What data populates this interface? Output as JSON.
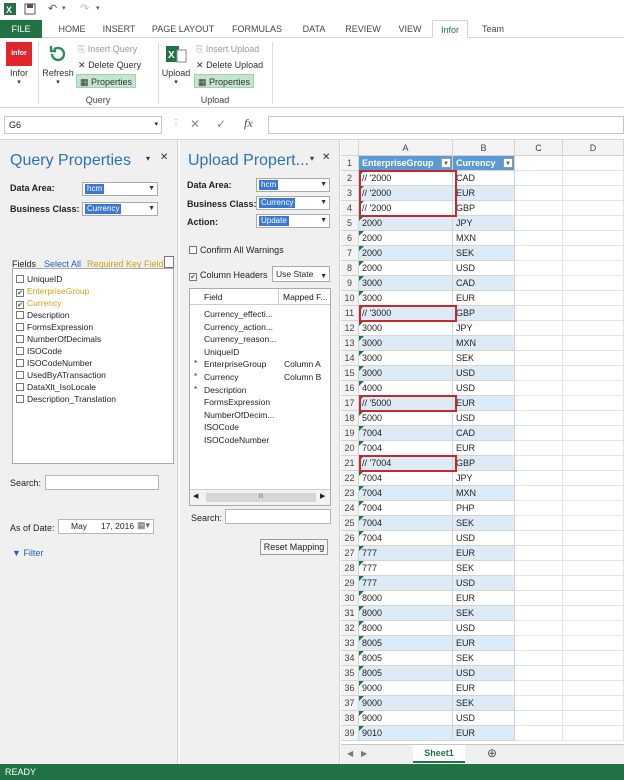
{
  "ribbon": {
    "tabs": [
      "FILE",
      "HOME",
      "INSERT",
      "PAGE LAYOUT",
      "FORMULAS",
      "DATA",
      "REVIEW",
      "VIEW",
      "Infor",
      "Team"
    ],
    "infor_label": "Infor",
    "refresh_label": "Refresh",
    "insert_query": "Insert Query",
    "delete_query": "Delete Query",
    "properties": "Properties",
    "query_group": "Query",
    "upload_label": "Upload",
    "insert_upload": "Insert Upload",
    "delete_upload": "Delete Upload",
    "upload_group": "Upload",
    "accent": "#217346"
  },
  "formula_bar": {
    "name_box": "G6",
    "fx": "fx"
  },
  "query_pane": {
    "title": "Query Properties",
    "data_area_label": "Data Area:",
    "data_area_value": "hcm",
    "business_class_label": "Business Class:",
    "business_class_value": "Currency",
    "fields_label": "Fields",
    "select_all": "Select All",
    "required_key_fields": "Required Key Fields",
    "fields": [
      {
        "name": "UniqueID",
        "checked": false
      },
      {
        "name": "EnterpriseGroup",
        "checked": true
      },
      {
        "name": "Currency",
        "checked": true
      },
      {
        "name": "Description",
        "checked": false
      },
      {
        "name": "FormsExpression",
        "checked": false
      },
      {
        "name": "NumberOfDecimals",
        "checked": false
      },
      {
        "name": "ISOCode",
        "checked": false
      },
      {
        "name": "ISOCodeNumber",
        "checked": false
      },
      {
        "name": "UsedByATransaction",
        "checked": false
      },
      {
        "name": "DataXlt_IsoLocale",
        "checked": false
      },
      {
        "name": "Description_Translation",
        "checked": false
      }
    ],
    "search_label": "Search:",
    "as_of_label": "As of Date:",
    "as_of_month": "May",
    "as_of_day_year": "17, 2016",
    "filter_label": "Filter"
  },
  "upload_pane": {
    "title": "Upload Propert...",
    "data_area_label": "Data Area:",
    "data_area_value": "hcm",
    "business_class_label": "Business Class:",
    "business_class_value": "Currency",
    "action_label": "Action:",
    "action_value": "Update",
    "confirm_all": "Confirm All Warnings",
    "column_headers": "Column Headers",
    "use_state": "Use State",
    "col_field": "Field",
    "col_mapped": "Mapped F...",
    "rows": [
      {
        "star": "",
        "field": "Currency_effecti...",
        "mapped": ""
      },
      {
        "star": "",
        "field": "Currency_action...",
        "mapped": ""
      },
      {
        "star": "",
        "field": "Currency_reason...",
        "mapped": ""
      },
      {
        "star": "",
        "field": "UniqueID",
        "mapped": ""
      },
      {
        "star": "*",
        "field": "EnterpriseGroup",
        "mapped": "Column A"
      },
      {
        "star": "*",
        "field": "Currency",
        "mapped": "Column B"
      },
      {
        "star": "*",
        "field": "Description",
        "mapped": ""
      },
      {
        "star": "",
        "field": "FormsExpression",
        "mapped": ""
      },
      {
        "star": "",
        "field": "NumberOfDecim...",
        "mapped": ""
      },
      {
        "star": "",
        "field": "ISOCode",
        "mapped": ""
      },
      {
        "star": "",
        "field": "ISOCodeNumber",
        "mapped": ""
      }
    ],
    "scroll_thumb": "III",
    "search_label": "Search:",
    "reset_mapping": "Reset Mapping"
  },
  "sheet": {
    "columns": [
      "A",
      "B",
      "C",
      "D"
    ],
    "header_a": "EnterpriseGroup",
    "header_b": "Currency",
    "rows": [
      [
        "// '2000",
        "CAD"
      ],
      [
        "// '2000",
        "EUR"
      ],
      [
        "// '2000",
        "GBP"
      ],
      [
        "2000",
        "JPY"
      ],
      [
        "2000",
        "MXN"
      ],
      [
        "2000",
        "SEK"
      ],
      [
        "2000",
        "USD"
      ],
      [
        "3000",
        "CAD"
      ],
      [
        "3000",
        "EUR"
      ],
      [
        "// '3000",
        "GBP"
      ],
      [
        "3000",
        "JPY"
      ],
      [
        "3000",
        "MXN"
      ],
      [
        "3000",
        "SEK"
      ],
      [
        "3000",
        "USD"
      ],
      [
        "4000",
        "USD"
      ],
      [
        "// '5000",
        "EUR"
      ],
      [
        "5000",
        "USD"
      ],
      [
        "7004",
        "CAD"
      ],
      [
        "7004",
        "EUR"
      ],
      [
        "// '7004",
        "GBP"
      ],
      [
        "7004",
        "JPY"
      ],
      [
        "7004",
        "MXN"
      ],
      [
        "7004",
        "PHP"
      ],
      [
        "7004",
        "SEK"
      ],
      [
        "7004",
        "USD"
      ],
      [
        "777",
        "EUR"
      ],
      [
        "777",
        "SEK"
      ],
      [
        "777",
        "USD"
      ],
      [
        "8000",
        "EUR"
      ],
      [
        "8000",
        "SEK"
      ],
      [
        "8000",
        "USD"
      ],
      [
        "8005",
        "EUR"
      ],
      [
        "8005",
        "SEK"
      ],
      [
        "8005",
        "USD"
      ],
      [
        "9000",
        "EUR"
      ],
      [
        "9000",
        "SEK"
      ],
      [
        "9000",
        "USD"
      ],
      [
        "9010",
        "EUR"
      ]
    ],
    "tab": "Sheet1",
    "add_sheet": "⊕"
  },
  "status": "READY"
}
